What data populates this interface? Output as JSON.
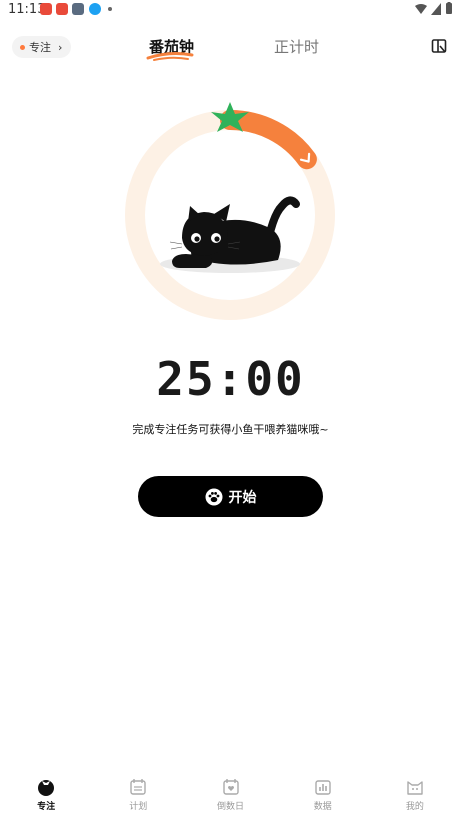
{
  "status_bar": {
    "time": "11:13"
  },
  "header": {
    "focus_chip": {
      "label": "专注",
      "arrow": "›"
    },
    "tabs": [
      {
        "label": "番茄钟",
        "active": true
      },
      {
        "label": "正计时",
        "active": false
      }
    ],
    "right_icon": "book-icon"
  },
  "timer": {
    "time": "25:00",
    "subtitle": "完成专注任务可获得小鱼干喂养猫咪哦~",
    "progress_fraction": 0.15
  },
  "start_button": {
    "label": "开始",
    "icon": "paw-icon"
  },
  "colors": {
    "accent_orange": "#f5813d",
    "ring_bg": "#fdf1e5",
    "leaf_green": "#2fb25a"
  },
  "bottom_nav": [
    {
      "label": "专注",
      "icon": "tomato-icon",
      "active": true
    },
    {
      "label": "计划",
      "icon": "calendar-list-icon",
      "active": false
    },
    {
      "label": "倒数日",
      "icon": "calendar-heart-icon",
      "active": false
    },
    {
      "label": "数据",
      "icon": "chart-icon",
      "active": false
    },
    {
      "label": "我的",
      "icon": "cat-face-icon",
      "active": false
    }
  ]
}
